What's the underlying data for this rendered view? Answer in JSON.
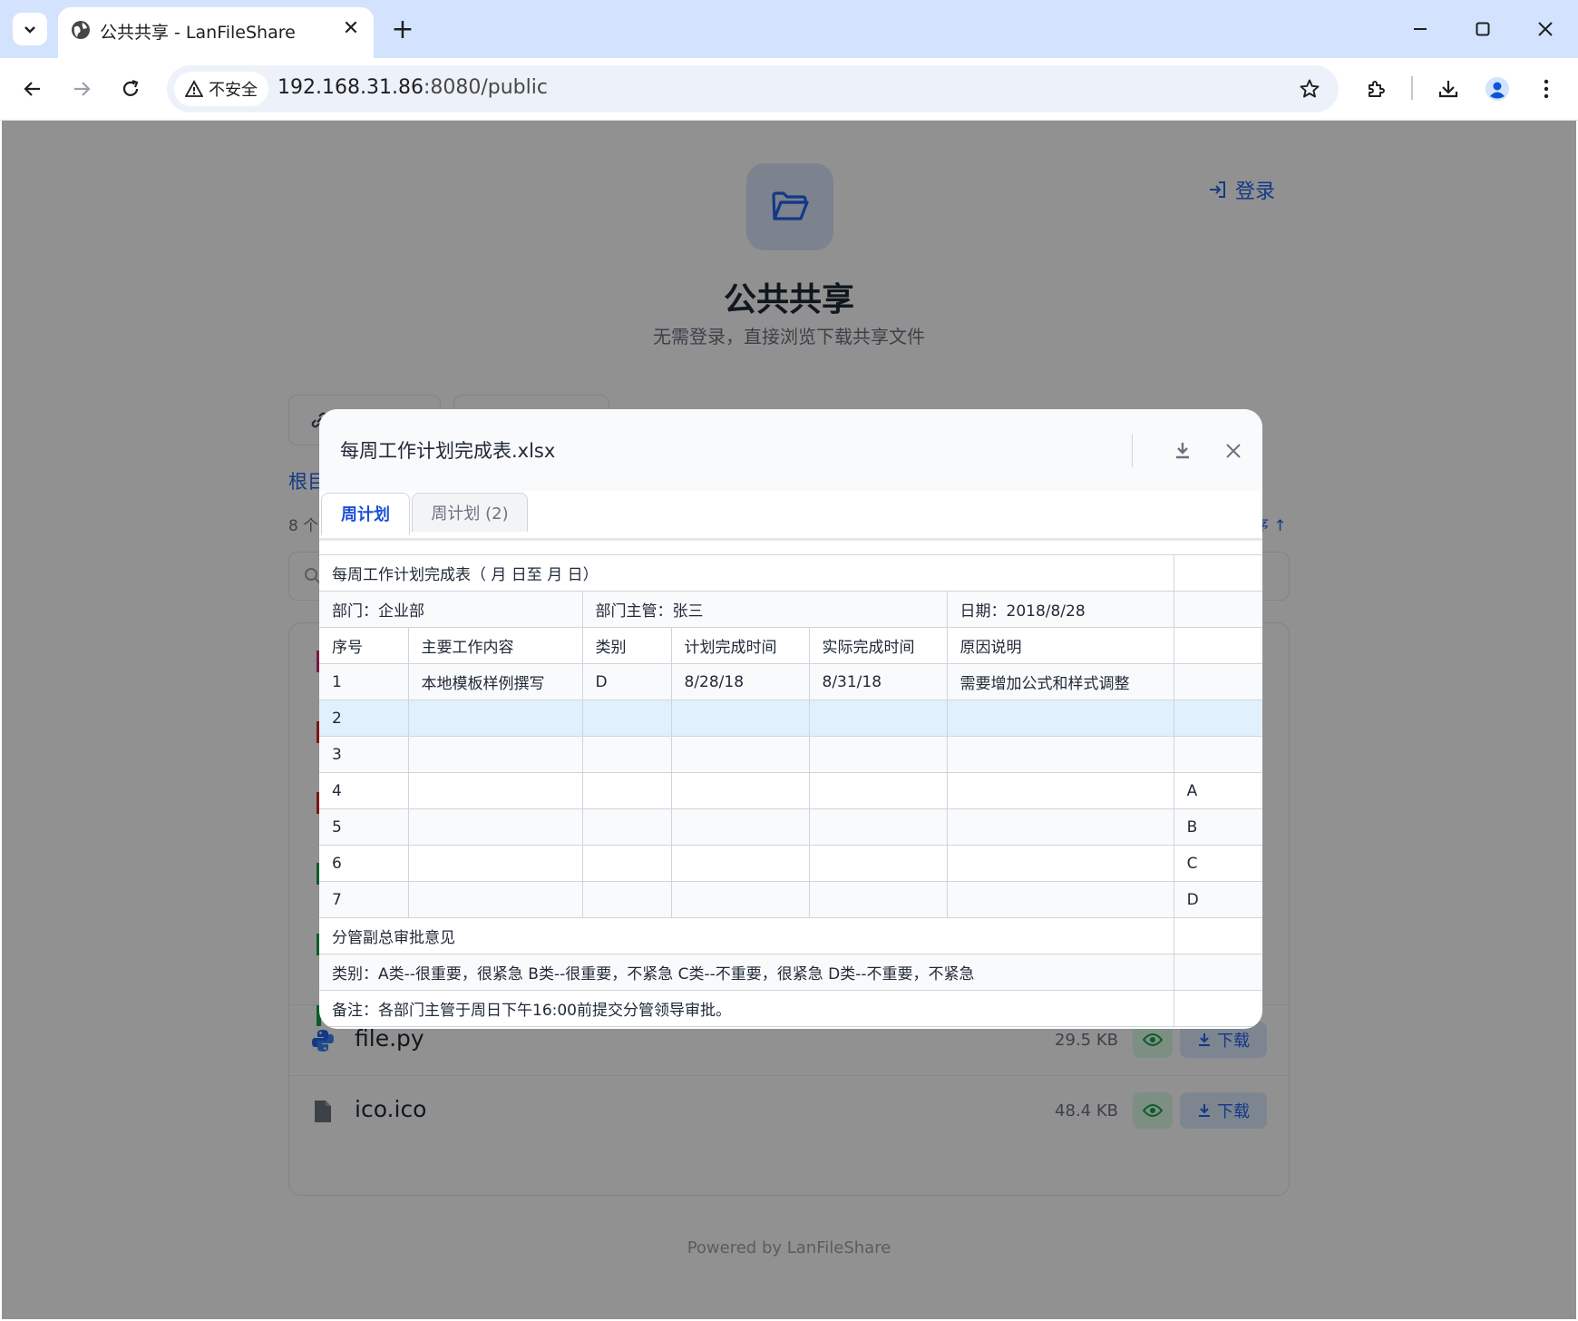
{
  "browser": {
    "tab_title": "公共共享 - LanFileShare",
    "close_glyph": "✕",
    "new_tab_glyph": "+",
    "security_label": "不安全",
    "url_host": "192.168.31.86",
    "url_rest": ":8080/public"
  },
  "page": {
    "login_label": "登录",
    "title": "公共共享",
    "subtitle": "无需登录，直接浏览下载共享文件",
    "breadcrumb_root": "根目",
    "file_count_prefix": "8 个",
    "sort_suffix": "序 ↑",
    "files": [
      {
        "name": "file.py",
        "size": "29.5 KB",
        "download_label": "下载",
        "icon": "python-icon"
      },
      {
        "name": "ico.ico",
        "size": "48.4 KB",
        "download_label": "下载",
        "icon": "file-icon"
      }
    ],
    "footer": "Powered by LanFileShare"
  },
  "modal": {
    "title": "每周工作计划完成表.xlsx",
    "sheet_tabs": [
      "周计划",
      "周计划 (2)"
    ],
    "rows": [
      {
        "cells": [
          "每周工作计划完成表（ 月 日至 月 日）",
          ""
        ],
        "spans": [
          6,
          1
        ]
      },
      {
        "cells": [
          "部门：企业部",
          "部门主管：张三",
          "日期：2018/8/28",
          ""
        ],
        "spans": [
          2,
          3,
          1,
          1
        ]
      },
      {
        "cells": [
          "序号",
          "主要工作内容",
          "类别",
          "计划完成时间",
          "实际完成时间",
          "原因说明",
          ""
        ],
        "spans": [
          1,
          1,
          1,
          1,
          1,
          1,
          1
        ]
      },
      {
        "cells": [
          "1",
          "本地模板样例撰写",
          "D",
          "8/28/18",
          "8/31/18",
          "需要增加公式和样式调整",
          ""
        ],
        "spans": [
          1,
          1,
          1,
          1,
          1,
          1,
          1
        ]
      },
      {
        "cells": [
          "2",
          "",
          "",
          "",
          "",
          "",
          ""
        ],
        "spans": [
          1,
          1,
          1,
          1,
          1,
          1,
          1
        ],
        "highlight": true
      },
      {
        "cells": [
          "3",
          "",
          "",
          "",
          "",
          "",
          ""
        ],
        "spans": [
          1,
          1,
          1,
          1,
          1,
          1,
          1
        ]
      },
      {
        "cells": [
          "4",
          "",
          "",
          "",
          "",
          "",
          "A"
        ],
        "spans": [
          1,
          1,
          1,
          1,
          1,
          1,
          1
        ]
      },
      {
        "cells": [
          "5",
          "",
          "",
          "",
          "",
          "",
          "B"
        ],
        "spans": [
          1,
          1,
          1,
          1,
          1,
          1,
          1
        ]
      },
      {
        "cells": [
          "6",
          "",
          "",
          "",
          "",
          "",
          "C"
        ],
        "spans": [
          1,
          1,
          1,
          1,
          1,
          1,
          1
        ]
      },
      {
        "cells": [
          "7",
          "",
          "",
          "",
          "",
          "",
          "D"
        ],
        "spans": [
          1,
          1,
          1,
          1,
          1,
          1,
          1
        ]
      },
      {
        "cells": [
          "分管副总审批意见",
          ""
        ],
        "spans": [
          6,
          1
        ]
      },
      {
        "cells": [
          "类别：A类--很重要，很紧急 B类--很重要，不紧急 C类--不重要，很紧急 D类--不重要，不紧急",
          ""
        ],
        "spans": [
          6,
          1
        ]
      },
      {
        "cells": [
          "备注：各部门主管于周日下午16:00前提交分管领导审批。",
          ""
        ],
        "spans": [
          6,
          1
        ]
      }
    ]
  },
  "colors": {
    "accent": "#2563eb",
    "active_tab": "#1d4ed8",
    "highlight_row": "#e0f0fd"
  }
}
